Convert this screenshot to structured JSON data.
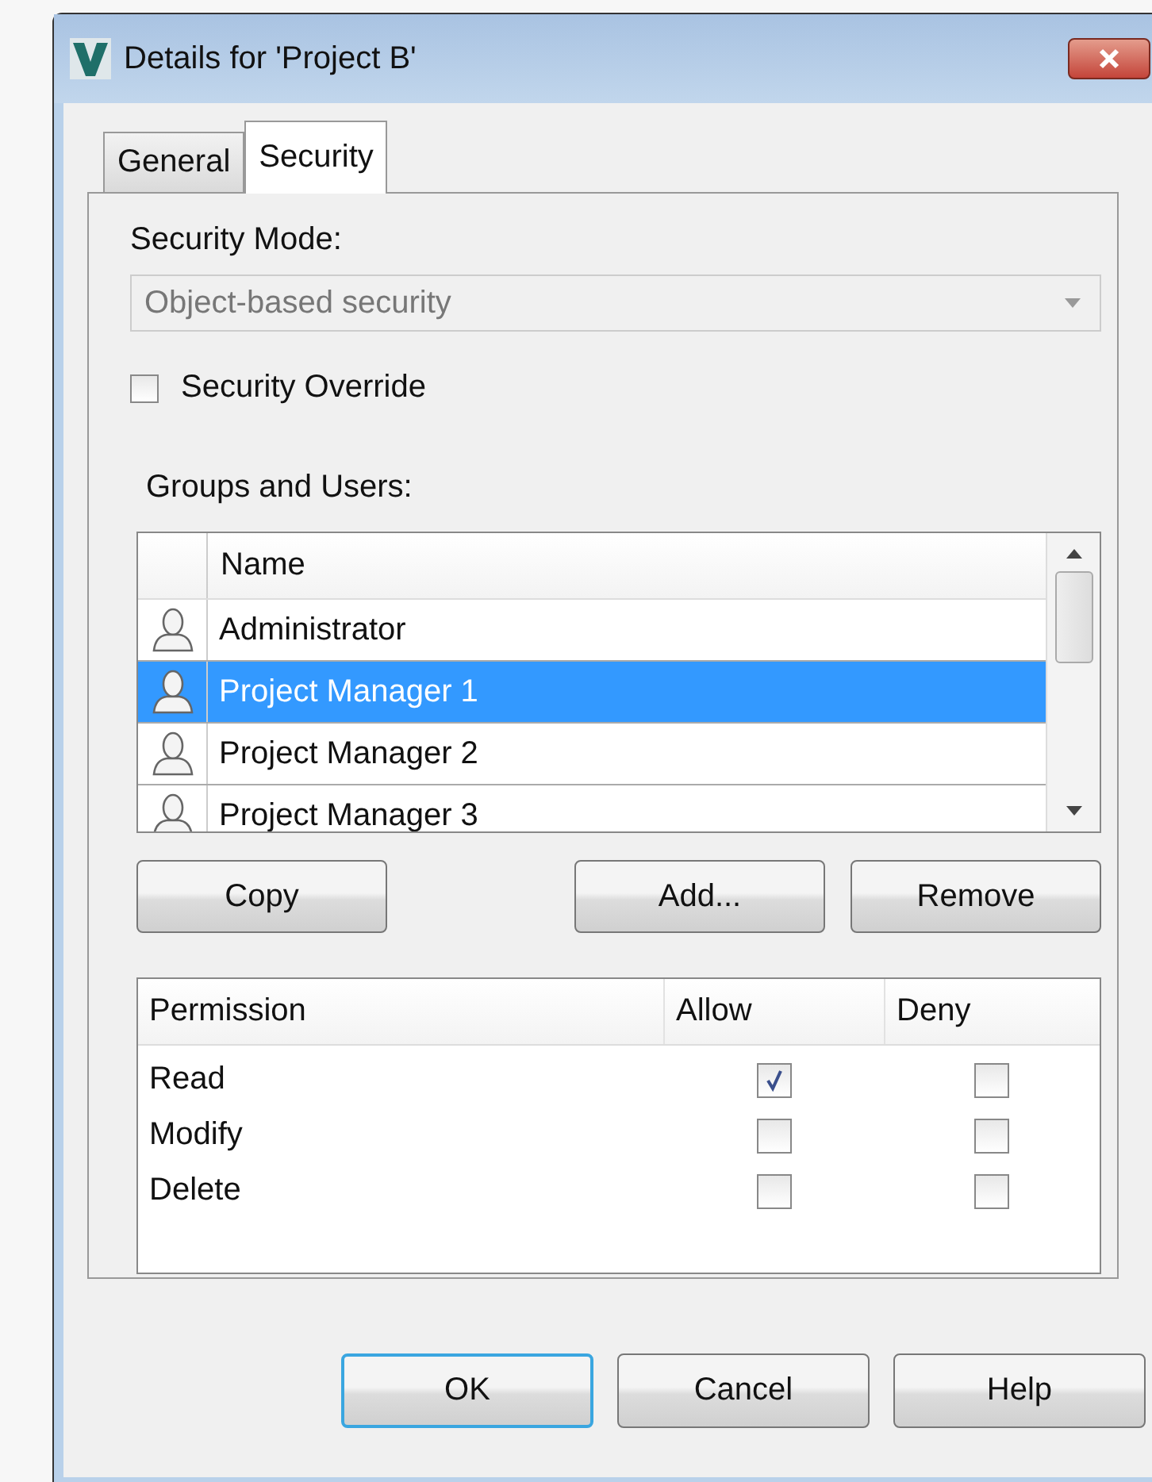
{
  "window": {
    "title": "Details for 'Project B'"
  },
  "tabs": [
    {
      "label": "General",
      "selected": false
    },
    {
      "label": "Security",
      "selected": true
    }
  ],
  "security_mode": {
    "label": "Security Mode:",
    "value": "Object-based security",
    "disabled": true
  },
  "override": {
    "label": "Security Override",
    "checked": false
  },
  "groups_label": "Groups and Users:",
  "users": {
    "column": "Name",
    "rows": [
      {
        "name": "Administrator",
        "selected": false
      },
      {
        "name": "Project Manager 1",
        "selected": true
      },
      {
        "name": "Project Manager 2",
        "selected": false
      },
      {
        "name": "Project Manager 3",
        "selected": false
      }
    ]
  },
  "user_buttons": [
    "Copy",
    "Add...",
    "Remove"
  ],
  "permissions": {
    "columns": [
      "Permission",
      "Allow",
      "Deny"
    ],
    "rows": [
      {
        "name": "Read",
        "allow": true,
        "deny": false
      },
      {
        "name": "Modify",
        "allow": false,
        "deny": false
      },
      {
        "name": "Delete",
        "allow": false,
        "deny": false
      }
    ]
  },
  "footer_buttons": [
    {
      "label": "OK",
      "default": true
    },
    {
      "label": "Cancel",
      "default": false
    },
    {
      "label": "Help",
      "default": false
    }
  ]
}
